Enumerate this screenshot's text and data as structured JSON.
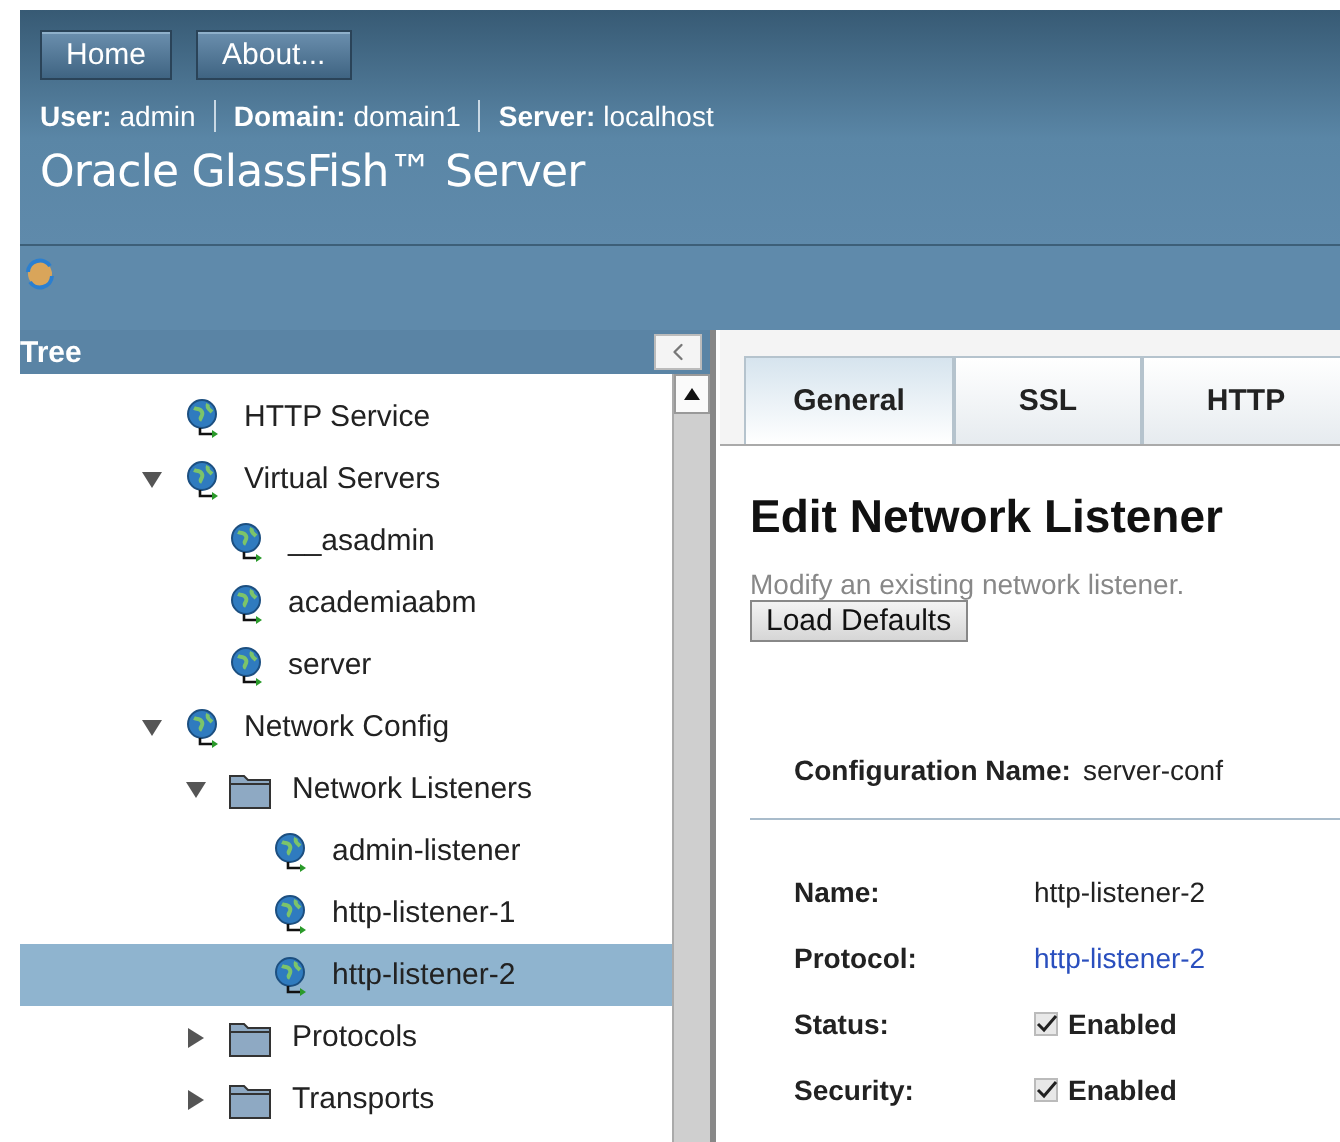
{
  "header": {
    "nav_buttons": [
      "Home",
      "About..."
    ],
    "info": [
      {
        "label": "User:",
        "value": "admin"
      },
      {
        "label": "Domain:",
        "value": "domain1"
      },
      {
        "label": "Server:",
        "value": "localhost"
      }
    ],
    "product": "Oracle GlassFish™ Server"
  },
  "tree": {
    "title": "Tree",
    "items": [
      {
        "label": "HTTP Service",
        "kind": "globe",
        "selected": false
      },
      {
        "label": "Virtual Servers",
        "kind": "globe",
        "selected": false,
        "expanded": true,
        "children": [
          {
            "label": "__asadmin",
            "kind": "globe",
            "selected": false
          },
          {
            "label": "academiaabm",
            "kind": "globe",
            "selected": false
          },
          {
            "label": "server",
            "kind": "globe",
            "selected": false
          }
        ]
      },
      {
        "label": "Network Config",
        "kind": "globe",
        "selected": false,
        "expanded": true,
        "children": [
          {
            "label": "Network Listeners",
            "kind": "folder",
            "selected": false,
            "expanded": true,
            "children": [
              {
                "label": "admin-listener",
                "kind": "globe",
                "selected": false
              },
              {
                "label": "http-listener-1",
                "kind": "globe",
                "selected": false
              },
              {
                "label": "http-listener-2",
                "kind": "globe",
                "selected": true
              }
            ]
          },
          {
            "label": "Protocols",
            "kind": "folder",
            "selected": false,
            "expanded": false
          },
          {
            "label": "Transports",
            "kind": "folder",
            "selected": false,
            "expanded": false
          }
        ]
      }
    ]
  },
  "tabs": [
    {
      "label": "General",
      "selected": true
    },
    {
      "label": "SSL",
      "selected": false
    },
    {
      "label": "HTTP",
      "selected": false
    }
  ],
  "page": {
    "title": "Edit Network Listener",
    "description": "Modify an existing network listener.",
    "button": "Load Defaults",
    "config_label": "Configuration Name:",
    "config_value": "server-conf",
    "properties": [
      {
        "label": "Name:",
        "kind": "text",
        "value": "http-listener-2"
      },
      {
        "label": "Protocol:",
        "kind": "link",
        "value": "http-listener-2"
      },
      {
        "label": "Status:",
        "kind": "checkbox",
        "value": "Enabled",
        "checked": true
      },
      {
        "label": "Security:",
        "kind": "checkbox",
        "value": "Enabled",
        "checked": true
      }
    ]
  }
}
